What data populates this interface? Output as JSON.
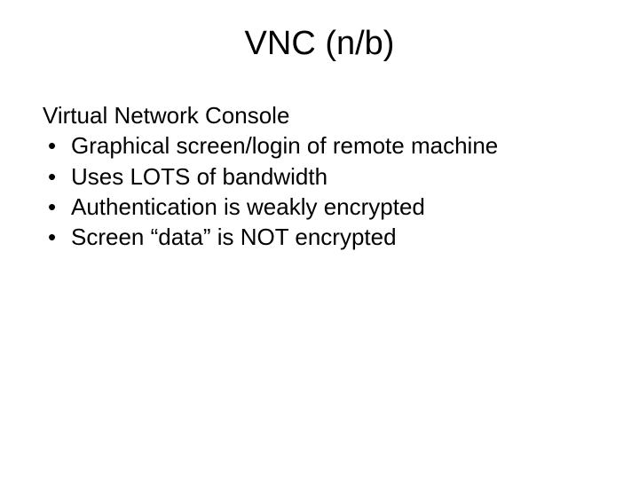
{
  "slide": {
    "title": "VNC (n/b)",
    "intro": "Virtual Network Console",
    "bullets": [
      "Graphical screen/login of remote machine",
      "Uses LOTS of bandwidth",
      "Authentication is weakly encrypted",
      "Screen “data” is NOT encrypted"
    ]
  }
}
